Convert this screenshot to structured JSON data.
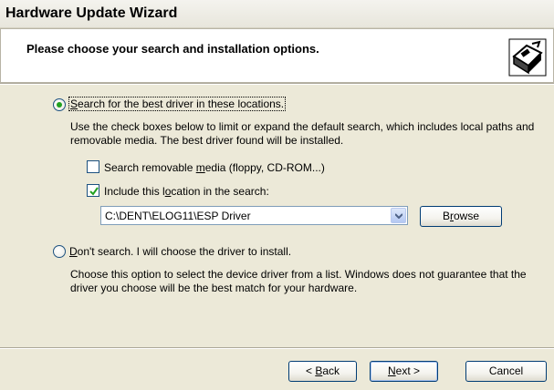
{
  "window": {
    "title": "Hardware Update Wizard"
  },
  "header": {
    "heading": "Please choose your search and installation options."
  },
  "option_search": {
    "label_pre": "",
    "label_accel": "S",
    "label_post": "earch for the best driver in these locations.",
    "selected": true,
    "description": "Use the check boxes below to limit or expand the default search, which includes local paths and removable media. The best driver found will be installed."
  },
  "removable_media": {
    "label_pre": "Search removable ",
    "label_accel": "m",
    "label_post": "edia (floppy, CD-ROM...)",
    "checked": false
  },
  "include_location": {
    "label_pre": "Include this l",
    "label_accel": "o",
    "label_post": "cation in the search:",
    "checked": true
  },
  "location_combo": {
    "value": "C:\\DENT\\ELOG11\\ESP Driver"
  },
  "browse_button": {
    "label_pre": "B",
    "label_accel": "r",
    "label_post": "owse"
  },
  "option_dont_search": {
    "label_pre": "",
    "label_accel": "D",
    "label_post": "on't search. I will choose the driver to install.",
    "selected": false,
    "description": "Choose this option to select the device driver from a list.  Windows does not guarantee that the driver you choose will be the best match for your hardware."
  },
  "buttons": {
    "back": {
      "label_pre": "< ",
      "label_accel": "B",
      "label_post": "ack"
    },
    "next": {
      "label_pre": "",
      "label_accel": "N",
      "label_post": "ext >"
    },
    "cancel": {
      "label": "Cancel"
    }
  },
  "icons": {
    "header": "hardware-wizard-icon",
    "dropdown": "chevron-down-icon",
    "check": "checkmark-icon"
  },
  "colors": {
    "dialog_bg": "#ECE9D8",
    "header_bg": "#FFFFFF",
    "radio_dot": "#21A121",
    "button_border": "#003C74"
  }
}
